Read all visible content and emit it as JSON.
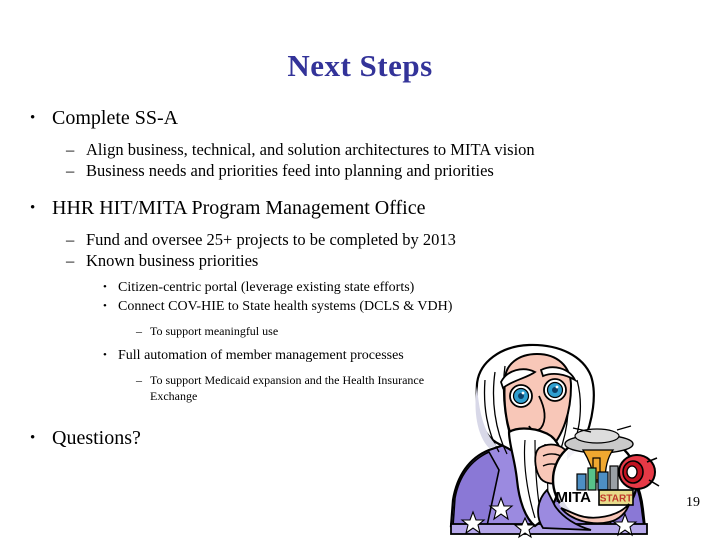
{
  "slide": {
    "title": "Next Steps",
    "title_color": "#333399",
    "page_number": "19",
    "background": "#ffffff",
    "text_color": "#000000"
  },
  "bullets": [
    {
      "level": 1,
      "mark": "•",
      "text": "Complete SS-A"
    },
    {
      "level": 2,
      "mark": "–",
      "text": "Align business, technical, and solution architectures to MITA vision"
    },
    {
      "level": 2,
      "mark": "–",
      "text": "Business needs and priorities feed into planning and priorities"
    },
    {
      "level": 1,
      "mark": "•",
      "text": "HHR HIT/MITA Program Management Office"
    },
    {
      "level": 2,
      "mark": "–",
      "text": "Fund and oversee 25+ projects to be completed by 2013"
    },
    {
      "level": 2,
      "mark": "–",
      "text": "Known business priorities"
    },
    {
      "level": 3,
      "mark": "•",
      "text": "Citizen-centric portal (leverage existing state efforts)"
    },
    {
      "level": 3,
      "mark": "•",
      "text": "Connect COV-HIE to State health systems (DCLS & VDH)"
    },
    {
      "level": 4,
      "mark": "–",
      "text": "To support meaningful use"
    },
    {
      "level": 3,
      "mark": "•",
      "text": "Full automation of member management processes"
    },
    {
      "level": 4,
      "mark": "–",
      "text": "To support Medicaid expansion and the Health Insurance Exchange"
    },
    {
      "level": 1,
      "mark": "•",
      "text": "Questions?"
    }
  ],
  "artwork": {
    "name": "wizard-with-crystal-ball",
    "crystal_ball_label": "MITA",
    "start_button_label": "START",
    "colors": {
      "robe": "#9b8ae0",
      "robe_shadow": "#7f6ecb",
      "skin": "#f8c7b8",
      "hair": "#ffffff",
      "hair_shade": "#d8d8e8",
      "eye": "#2f9fd0",
      "ball": "#ffffff",
      "ball_shade": "#e4e4ee",
      "start_button": "#e63946",
      "start_plate": "#e8dc8a",
      "cloud": "#c9c9c9",
      "blast": "#f0a830",
      "outline": "#000000"
    }
  }
}
